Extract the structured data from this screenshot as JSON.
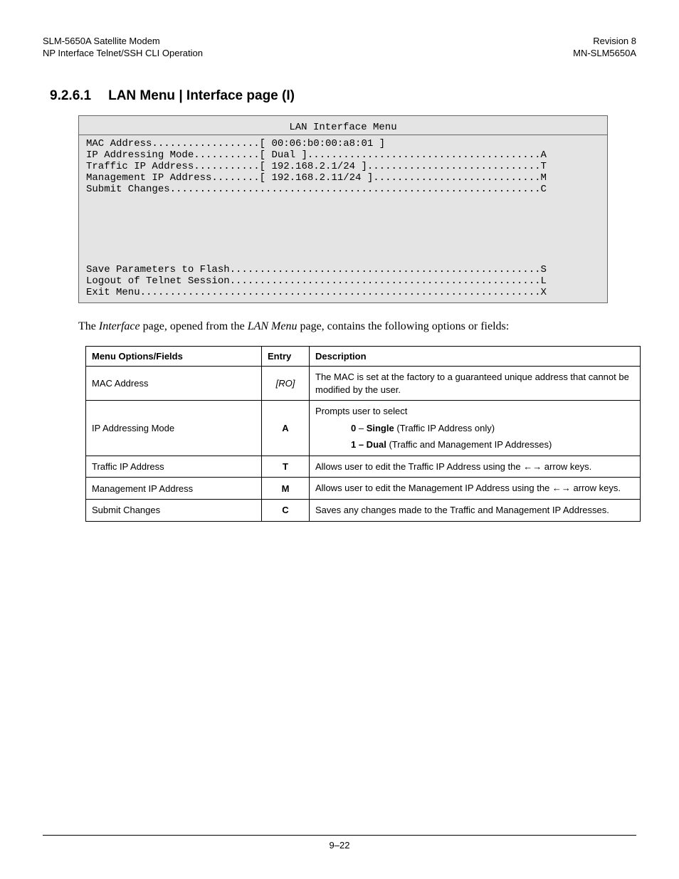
{
  "header": {
    "left_line1": "SLM-5650A Satellite Modem",
    "left_line2": "NP Interface Telnet/SSH CLI Operation",
    "right_line1": "Revision 8",
    "right_line2": "MN-SLM5650A"
  },
  "section": {
    "number": "9.2.6.1",
    "title": "LAN Menu | Interface page (I)"
  },
  "terminal": {
    "title": "LAN Interface Menu",
    "body": "MAC Address..................[ 00:06:b0:00:a8:01 ]\nIP Addressing Mode...........[ Dual ].......................................A\nTraffic IP Address...........[ 192.168.2.1/24 ].............................T\nManagement IP Address........[ 192.168.2.11/24 ]............................M\nSubmit Changes..............................................................C\n\n\n\n\n\n\nSave Parameters to Flash....................................................S\nLogout of Telnet Session....................................................L\nExit Menu...................................................................X"
  },
  "intro": {
    "pre": "The ",
    "italic1": "Interface",
    "mid": " page, opened from the ",
    "italic2": "LAN Menu",
    "post": " page, contains the following options or fields:"
  },
  "table": {
    "headers": {
      "col1": "Menu Options/Fields",
      "col2": "Entry",
      "col3": "Description"
    },
    "rows": [
      {
        "field": "MAC Address",
        "entry": "[RO]",
        "entry_italic": true,
        "desc_plain": "The MAC is set at the factory to a guaranteed unique address that cannot be modified by the user."
      },
      {
        "field": "IP Addressing Mode",
        "entry": "A",
        "entry_italic": false,
        "desc_prompt": "Prompts user to select",
        "desc_opts": [
          {
            "bold": "0",
            "sep": " – ",
            "bold2": "Single",
            "rest": " (Traffic IP Address only)"
          },
          {
            "bold": "1 – Dual",
            "sep": "",
            "bold2": "",
            "rest": " (Traffic and Management IP Addresses)"
          }
        ]
      },
      {
        "field": "Traffic IP Address",
        "entry": "T",
        "entry_italic": false,
        "desc_arrow_pre": "Allows user to edit the Traffic IP Address using the ",
        "desc_arrow_post": " arrow keys."
      },
      {
        "field": "Management IP Address",
        "entry": "M",
        "entry_italic": false,
        "desc_arrow_pre": "Allows user to edit the Management IP Address using the ",
        "desc_arrow_post": " arrow keys."
      },
      {
        "field": "Submit Changes",
        "entry": "C",
        "entry_italic": false,
        "desc_plain": "Saves any changes made to the Traffic and Management IP Addresses."
      }
    ]
  },
  "arrows": "←→",
  "footer": {
    "page_number": "9–22"
  }
}
